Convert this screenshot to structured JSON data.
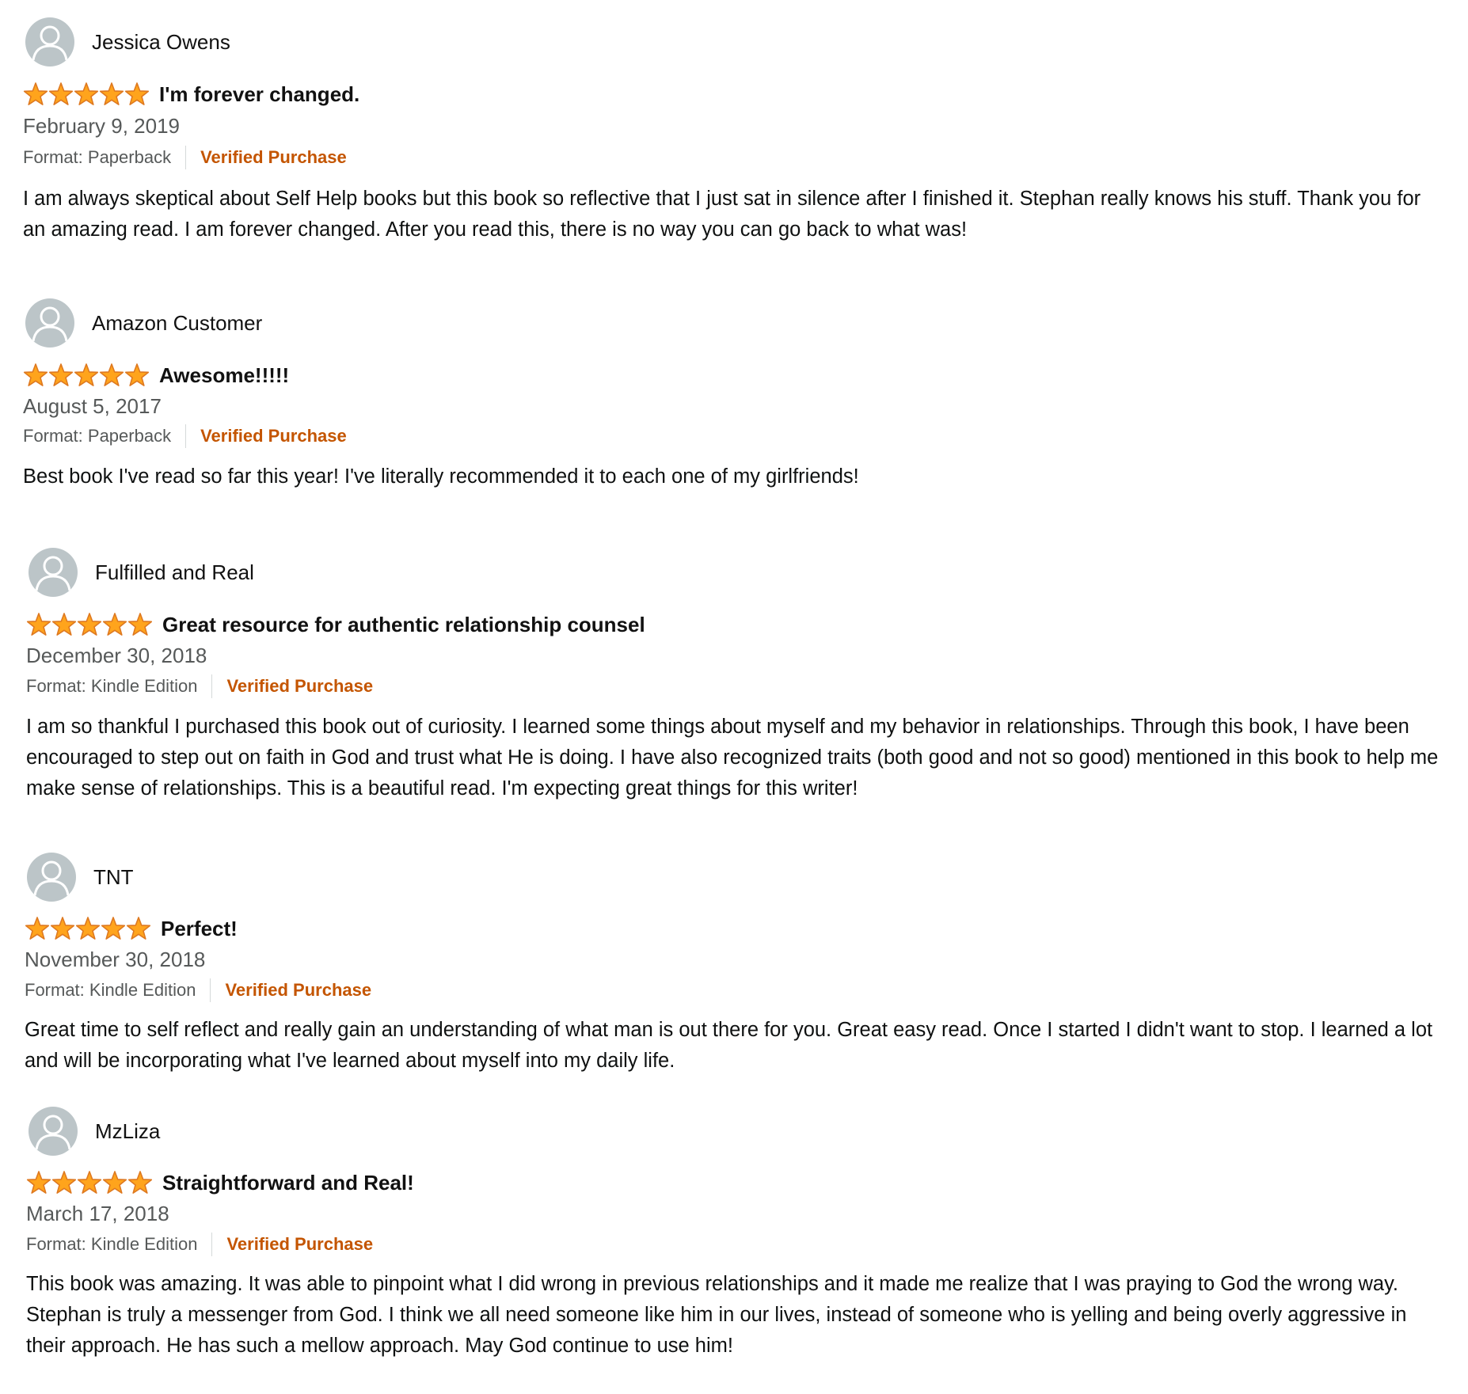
{
  "reviews": [
    {
      "name": "Jessica Owens",
      "rating": 5,
      "title": "I'm forever changed.",
      "date": "February 9, 2019",
      "format": "Format: Paperback",
      "verified": "Verified Purchase",
      "body": "I am always skeptical about Self Help books but this book so reflective that I just sat in silence after I finished it. Stephan really knows his stuff. Thank you for an amazing read. I am forever changed. After you read this, there is no way you can go back to what was!"
    },
    {
      "name": "Amazon Customer",
      "rating": 5,
      "title": "Awesome!!!!!",
      "date": "August 5, 2017",
      "format": "Format: Paperback",
      "verified": "Verified Purchase",
      "body": "Best book I've read so far this year! I've literally recommended it to each one of my girlfriends!"
    },
    {
      "name": "Fulfilled and Real",
      "rating": 5,
      "title": "Great resource for authentic relationship counsel",
      "date": "December 30, 2018",
      "format": "Format: Kindle Edition",
      "verified": "Verified Purchase",
      "body": "I am so thankful I purchased this book out of curiosity. I learned some things about myself and my behavior in relationships. Through this book, I have been encouraged to step out on faith in God and trust what He is doing. I have also recognized traits (both good and not so good) mentioned in this book to help me make sense of relationships. This is a beautiful read. I'm expecting great things for this writer!"
    },
    {
      "name": "TNT",
      "rating": 5,
      "title": "Perfect!",
      "date": "November 30, 2018",
      "format": "Format: Kindle Edition",
      "verified": "Verified Purchase",
      "body": "Great time to self reflect and really gain an understanding of what man is out there for you. Great easy read. Once I started I didn't want to stop. I learned a lot and will be incorporating what I've learned about myself into my daily life."
    },
    {
      "name": "MzLiza",
      "rating": 5,
      "title": "Straightforward and Real!",
      "date": "March 17, 2018",
      "format": "Format: Kindle Edition",
      "verified": "Verified Purchase",
      "body": "This book was amazing. It was able to pinpoint what I did wrong in previous relationships and it made me realize that I was praying to God the wrong way. Stephan is truly a messenger from God. I think we all need someone like him in our lives, instead of someone who is yelling and being overly aggressive in their approach. He has such a mellow approach. May God continue to use him!"
    }
  ],
  "icons": {
    "avatar": "user-avatar-icon",
    "star": "star-icon"
  },
  "colors": {
    "star_fill": "#ffa41c",
    "star_stroke": "#de7921",
    "verified": "#c45500",
    "avatar_bg": "#bcc5c8",
    "muted_text": "#565959"
  }
}
